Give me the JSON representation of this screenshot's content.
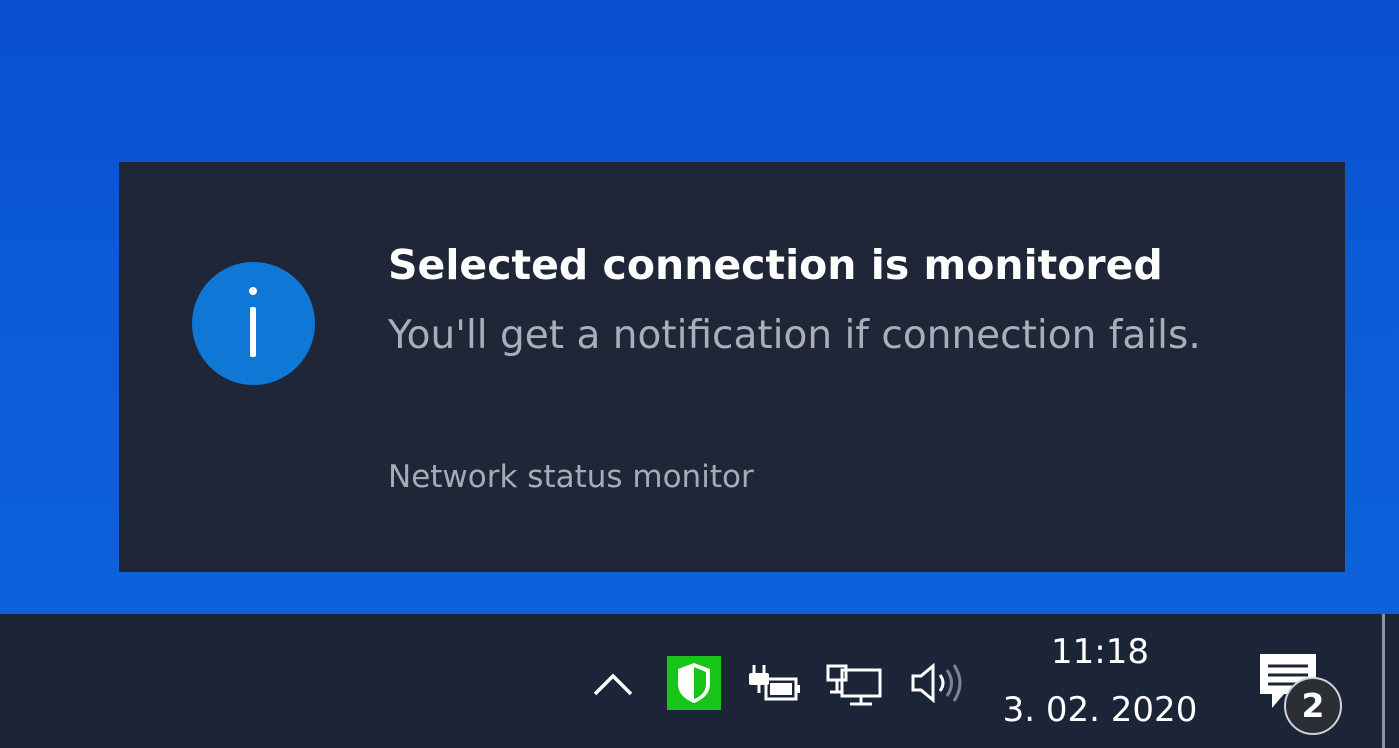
{
  "notification": {
    "title": "Selected connection is monitored",
    "body": "You'll get a notification if connection fails.",
    "source": "Network status monitor",
    "icon": "info-icon",
    "accent_color": "#0f78d7"
  },
  "taskbar": {
    "tray_icons": [
      {
        "name": "show-hidden-icons-chevron",
        "icon": "chevron-up-icon"
      },
      {
        "name": "security-shield",
        "icon": "shield-icon",
        "color": "#17c418"
      },
      {
        "name": "power",
        "icon": "battery-plug-icon"
      },
      {
        "name": "network",
        "icon": "network-monitor-icon"
      },
      {
        "name": "volume",
        "icon": "speaker-icon"
      }
    ],
    "clock": {
      "time": "11:18",
      "date": "3. 02. 2020"
    },
    "action_center": {
      "icon": "notification-icon",
      "badge_count": "2"
    }
  }
}
